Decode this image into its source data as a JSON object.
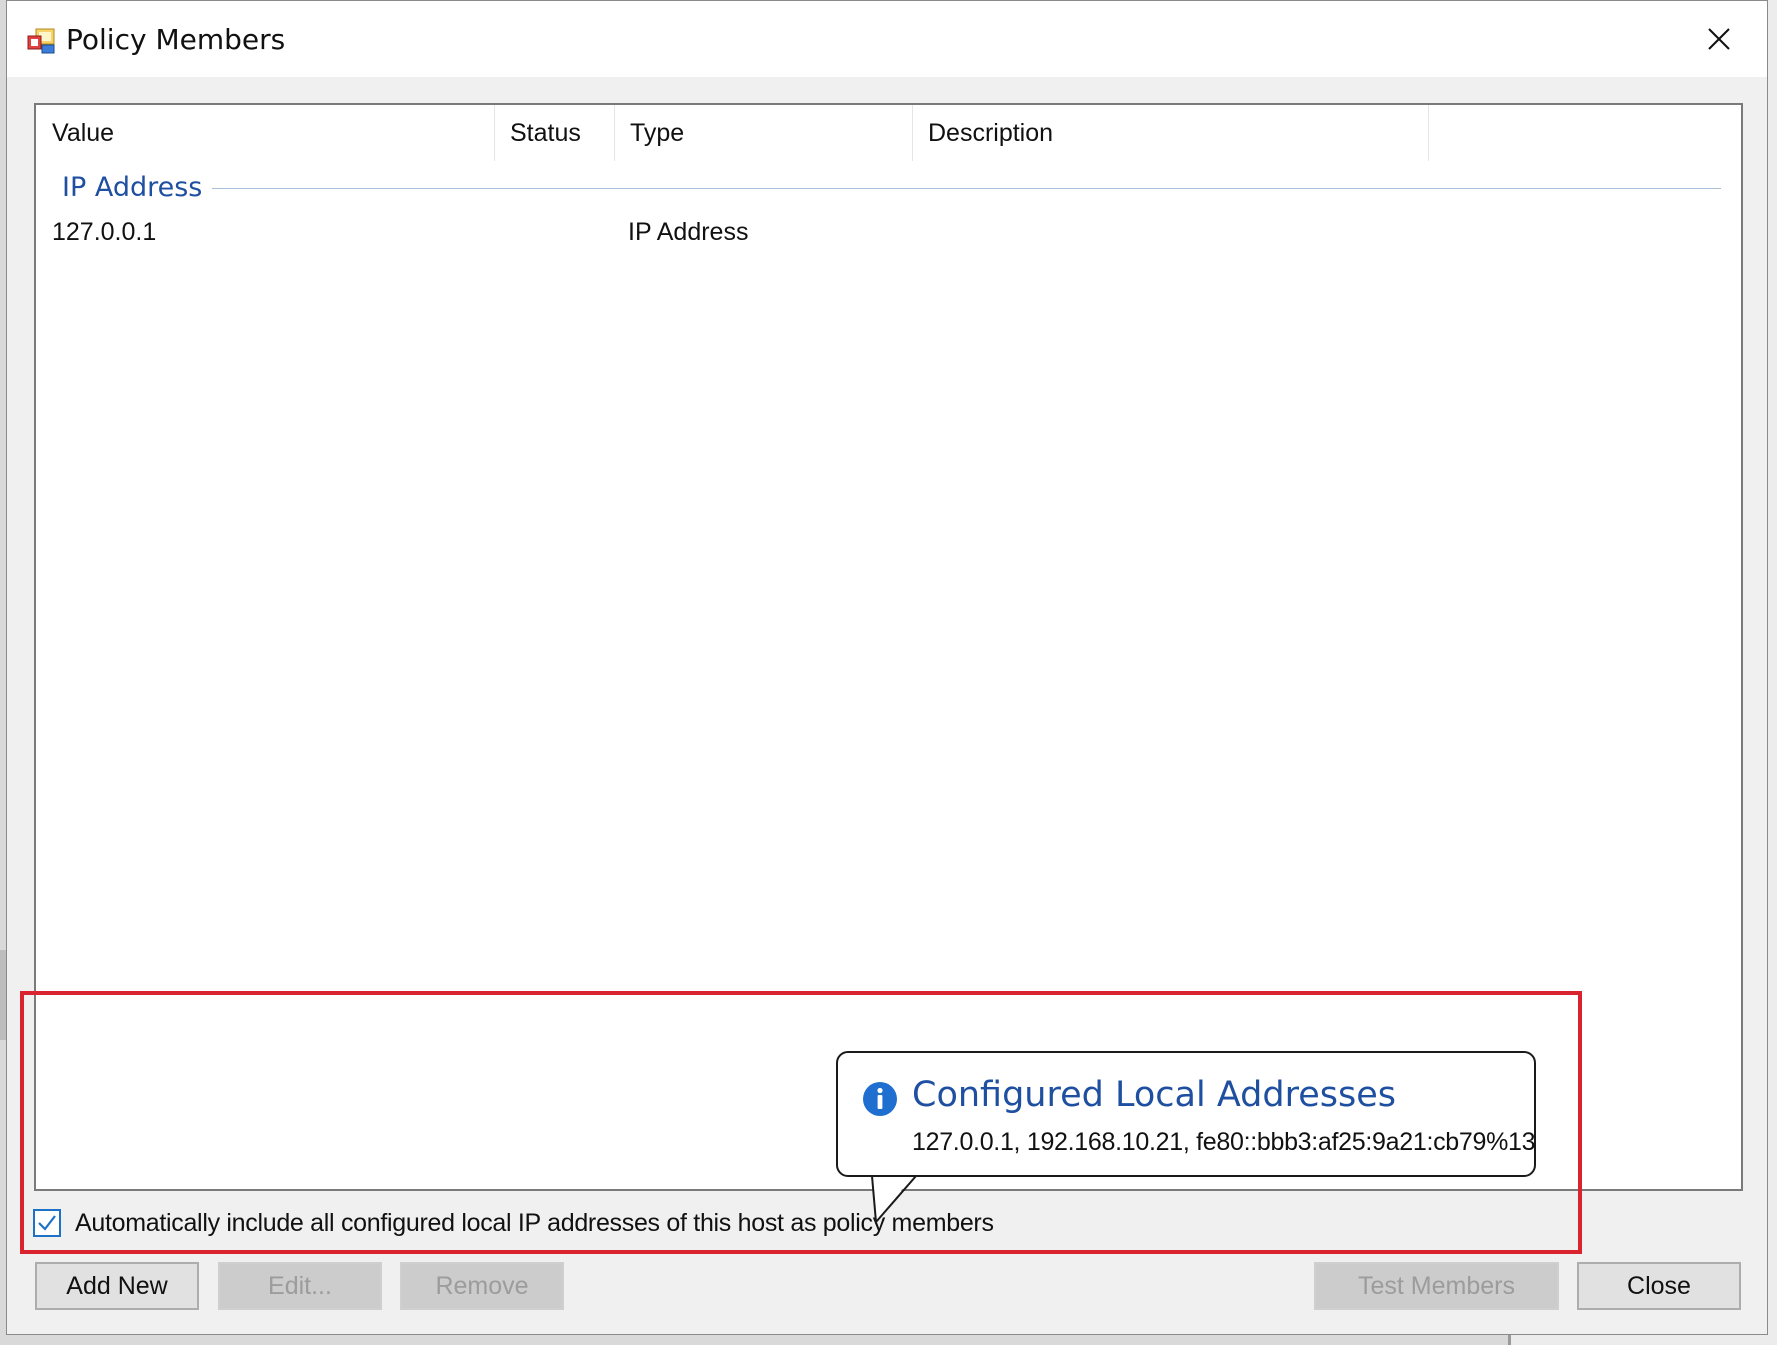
{
  "window": {
    "title": "Policy Members",
    "close_icon": "close-icon",
    "app_icon": "policy-app-icon"
  },
  "list": {
    "columns": [
      "Value",
      "Status",
      "Type",
      "Description"
    ],
    "groups": [
      {
        "label": "IP Address",
        "rows": [
          {
            "value": "127.0.0.1",
            "status": "",
            "type": "IP Address",
            "description": ""
          }
        ]
      }
    ]
  },
  "auto_include": {
    "checked": true,
    "label": "Automatically include all configured local IP addresses of this host as policy members"
  },
  "tooltip": {
    "icon": "info-icon",
    "title": "Configured Local Addresses",
    "text": "127.0.0.1, 192.168.10.21, fe80::bbb3:af25:9a21:cb79%13"
  },
  "buttons": {
    "add_new": "Add New",
    "edit": "Edit...",
    "remove": "Remove",
    "test_members": "Test Members",
    "close": "Close"
  },
  "colors": {
    "group_header": "#1e4fa0",
    "highlight": "#d9232e",
    "checkbox_accent": "#1d72c6"
  }
}
